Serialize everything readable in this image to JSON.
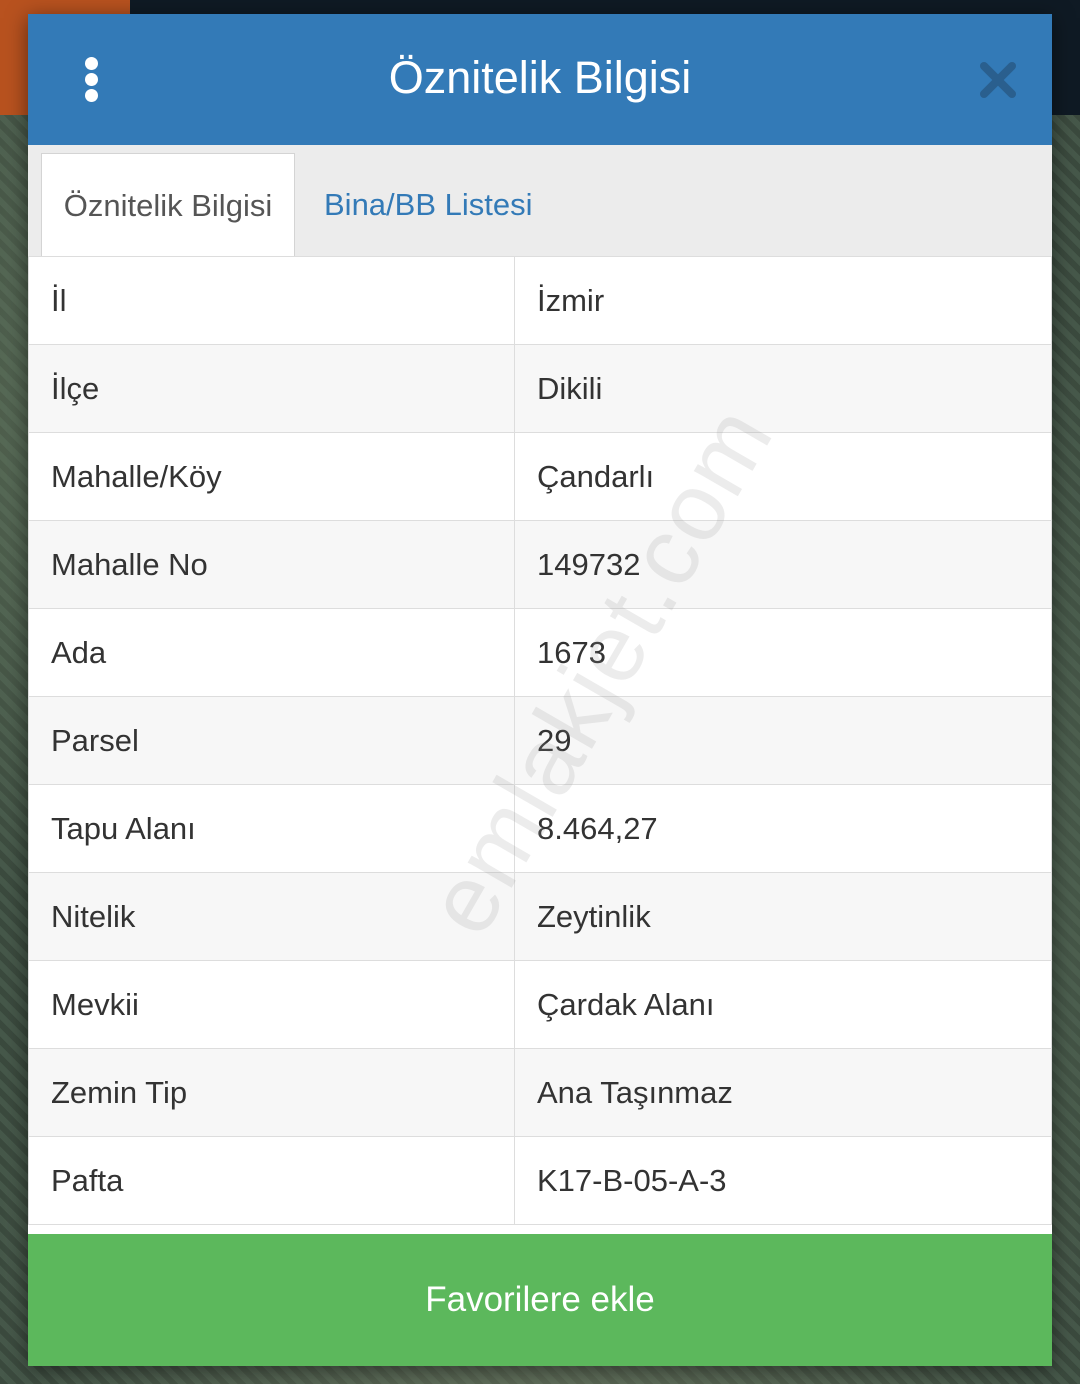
{
  "modal": {
    "title": "Öznitelik Bilgisi",
    "menu_icon": "vertical-dots-icon",
    "close_icon": "close-icon"
  },
  "tabs": [
    {
      "label": "Öznitelik Bilgisi",
      "active": true
    },
    {
      "label": "Bina/BB Listesi",
      "active": false
    }
  ],
  "attributes": [
    {
      "key": "İl",
      "value": "İzmir"
    },
    {
      "key": "İlçe",
      "value": "Dikili"
    },
    {
      "key": "Mahalle/Köy",
      "value": "Çandarlı"
    },
    {
      "key": "Mahalle No",
      "value": "149732"
    },
    {
      "key": "Ada",
      "value": "1673"
    },
    {
      "key": "Parsel",
      "value": "29"
    },
    {
      "key": "Tapu Alanı",
      "value": "8.464,27"
    },
    {
      "key": "Nitelik",
      "value": "Zeytinlik"
    },
    {
      "key": "Mevkii",
      "value": "Çardak Alanı"
    },
    {
      "key": "Zemin Tip",
      "value": "Ana Taşınmaz"
    },
    {
      "key": "Pafta",
      "value": "K17-B-05-A-3"
    }
  ],
  "favorite_button": {
    "label": "Favorilere ekle"
  },
  "watermark": "emlakjet.com",
  "colors": {
    "header": "#337ab7",
    "tab_link": "#337ab7",
    "button": "#5cb85c"
  }
}
